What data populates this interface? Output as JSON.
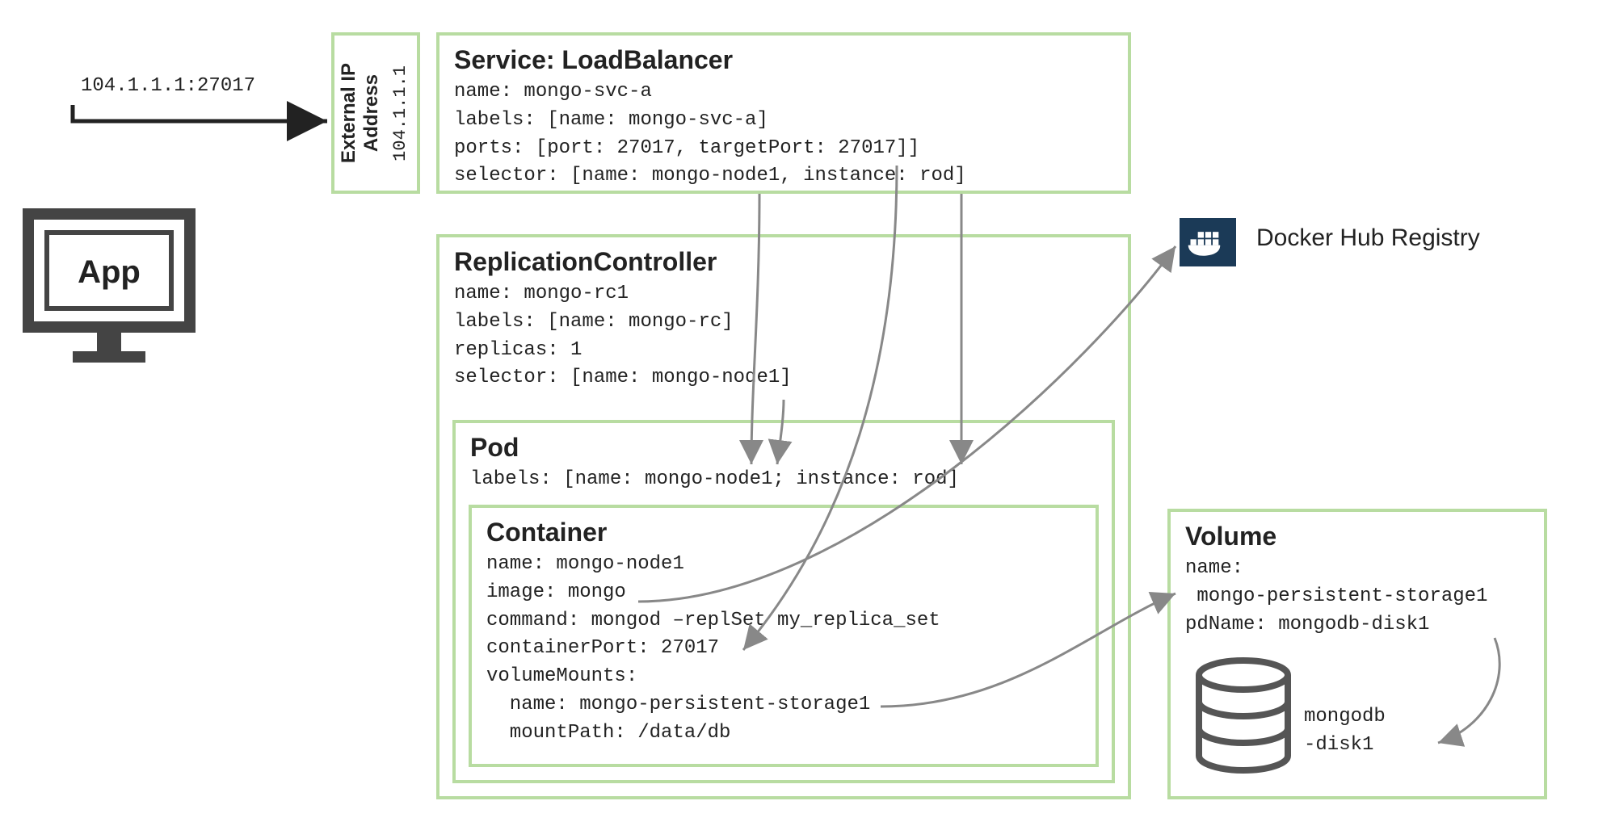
{
  "app": {
    "label": "App",
    "endpoint": "104.1.1.1:27017"
  },
  "externalIp": {
    "label1": "External IP",
    "label2": "Address",
    "value": "104.1.1.1"
  },
  "service": {
    "title": "Service: LoadBalancer",
    "line1": "name: mongo-svc-a",
    "line2": "labels: [name: mongo-svc-a]",
    "line3": "ports: [port: 27017, targetPort: 27017]]",
    "line4": "selector: [name: mongo-node1, instance: rod]"
  },
  "rc": {
    "title": "ReplicationController",
    "line1": "name: mongo-rc1",
    "line2": "labels: [name: mongo-rc]",
    "line3": "replicas: 1",
    "line4": "selector: [name: mongo-node1]"
  },
  "pod": {
    "title": "Pod",
    "line1": "labels: [name: mongo-node1; instance: rod]"
  },
  "container": {
    "title": "Container",
    "line1": "name: mongo-node1",
    "line2": "image: mongo",
    "line3": "command: mongod –replSet my_replica_set",
    "line4": "containerPort: 27017",
    "line5": "volumeMounts:",
    "line6": "  name: mongo-persistent-storage1",
    "line7": "  mountPath: /data/db"
  },
  "volume": {
    "title": "Volume",
    "line1": "name:",
    "line2": " mongo-persistent-storage1",
    "line3": "pdName: mongodb-disk1",
    "diskLabel1": "mongodb",
    "diskLabel2": "-disk1"
  },
  "docker": {
    "label": "Docker Hub Registry"
  }
}
